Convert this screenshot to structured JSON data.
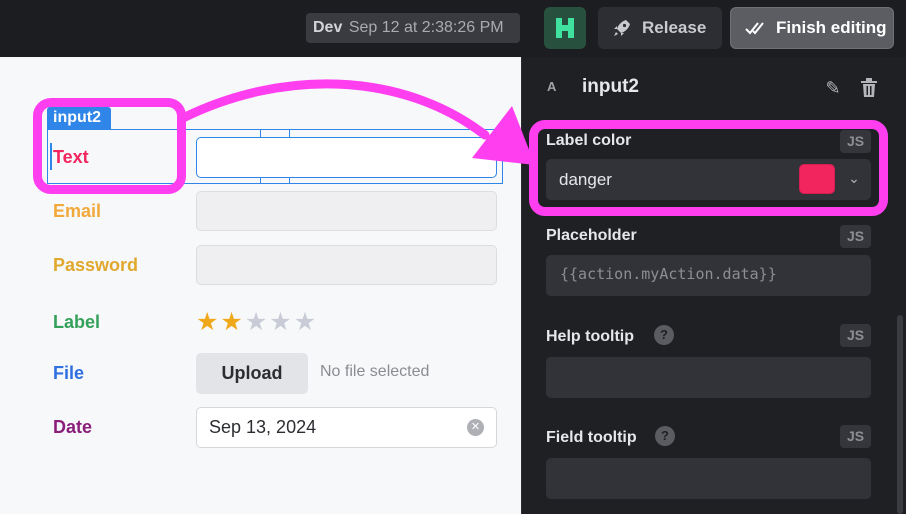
{
  "topbar": {
    "env_label": "Dev",
    "env_time": "Sep 12 at 2:38:26 PM",
    "release_label": "Release",
    "finish_label": "Finish editing"
  },
  "canvas": {
    "selected_name": "input2",
    "fields": [
      {
        "label": "Text",
        "color": "#f2255f"
      },
      {
        "label": "Email",
        "color": "#f2a93b"
      },
      {
        "label": "Password",
        "color": "#e0a82e"
      },
      {
        "label": "Label",
        "color": "#35a05a"
      },
      {
        "label": "File",
        "color": "#2f6fe0"
      },
      {
        "label": "Date",
        "color": "#8a1f7a"
      }
    ],
    "rating": {
      "value": 2,
      "max": 5
    },
    "upload_label": "Upload",
    "no_file_text": "No file selected",
    "date_value": "Sep 13, 2024"
  },
  "panel": {
    "component_icon": "A",
    "component_name": "input2",
    "js_label": "JS",
    "label_color": {
      "title": "Label color",
      "value": "danger",
      "swatch": "#f2255f"
    },
    "placeholder": {
      "title": "Placeholder",
      "value": "{{action.myAction.data}}"
    },
    "help_tooltip": {
      "title": "Help tooltip",
      "value": ""
    },
    "field_tooltip": {
      "title": "Field tooltip",
      "value": ""
    }
  }
}
